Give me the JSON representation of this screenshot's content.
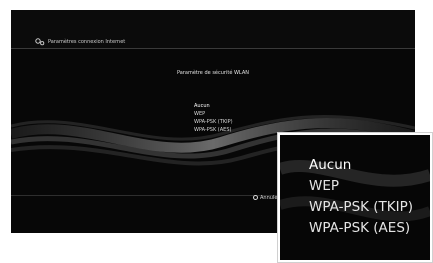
{
  "window": {
    "title": "Paramètres connexion Internet",
    "icon": "settings-gear-icon"
  },
  "dialog": {
    "title": "Paramètre de sécurité WLAN",
    "options": [
      "Aucun",
      "WEP",
      "WPA-PSK (TKIP)",
      "WPA-PSK (AES)"
    ],
    "selected": "Aucun"
  },
  "footer": {
    "cancel_label": "Annuler",
    "cancel_icon": "circle-button-icon"
  },
  "zoom": {
    "options": [
      "Aucun",
      "WEP",
      "WPA-PSK (TKIP)",
      "WPA-PSK (AES)"
    ],
    "selected": "Aucun"
  },
  "colors": {
    "background": "#070707",
    "text": "#d7d7d7",
    "selected_text": "#ffffff"
  }
}
